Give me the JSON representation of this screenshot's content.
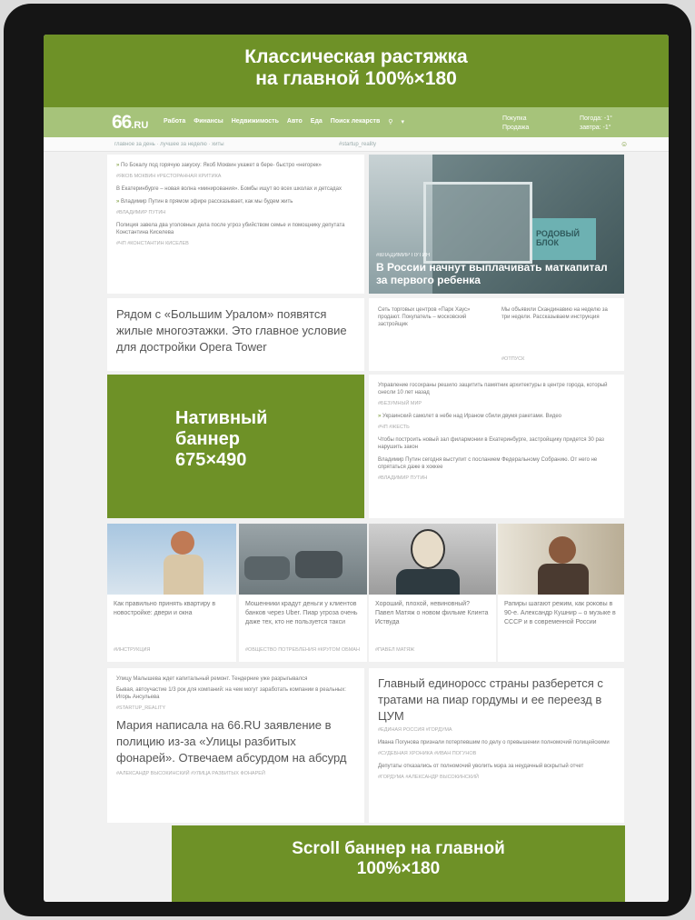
{
  "ads": {
    "top_line1": "Классическая растяжка",
    "top_line2": "на главной 100%×180",
    "native_line1": "Нативный",
    "native_line2": "баннер",
    "native_line3": "675×490",
    "bottom_line1": "Scroll баннер на главной",
    "bottom_line2": "100%×180"
  },
  "nav": {
    "logo": "66",
    "logo_suffix": ".RU",
    "items": [
      "Работа",
      "Финансы",
      "Недвижимость",
      "Авто",
      "Еда",
      "Поиск лекарств"
    ],
    "right1": [
      "Покупка",
      "Продажа"
    ],
    "right2": [
      "Погода: -1°",
      "завтра: -1°"
    ]
  },
  "subnav": {
    "left": "главное за день  ·  лучшее за неделю  ·  хиты",
    "middle": "#startup_reality"
  },
  "left_news": [
    {
      "text": "По Бокалу под горячую закуску: Якоб Моквин укажет в бере- быстро «негорек»",
      "tag": "#ЯКОБ МОКВИН  #РЕСТОРАННАЯ КРИТИКА"
    },
    {
      "text": "В Екатеринбурге – новая волна «минирования». Бомбы ищут во всех школах и детсадах",
      "tag": ""
    },
    {
      "text": "Владимир Путин в прямом эфире рассказывает, как мы будем жить",
      "tag": "#ВЛАДИМИР ПУТИН"
    },
    {
      "text": "Полиция завела два уголовных дела после угроз убийством семье и помощнику депутата Константина Киселева",
      "tag": "#ЧП  #КОНСТАНТИН КИСЕЛЕВ"
    }
  ],
  "main_photo": {
    "tag": "#ВЛАДИМИР ПУТИН",
    "title": "В России начнут выплачивать маткапитал за первого ребенка",
    "sign": "РОДОВЫЙ БЛОК"
  },
  "big_news": "Рядом с «Большим Уралом» появятся жилые многоэтажки. Это главное условие для достройки Opera Tower",
  "mid_news": [
    {
      "text": "Сеть торговых центров «Парк Хаус» продают. Покупатель – московский застройщик"
    },
    {
      "text": "Мы объявили Скандинавию на неделю за три недели. Рассказываем инструкция"
    }
  ],
  "mid_tag": "#ОТПУСК",
  "right_news": [
    {
      "text": "Управление госохраны решило защитить памятник архитектуры в центре города, который снесли 10 лет назад",
      "tag": "#БЕЗУМНЫЙ МИР"
    },
    {
      "text": "Украинский самолет в небе над Ираном сбили двумя ракетами. Видео",
      "tag": "#ЧП  #ЖЕСТЬ"
    },
    {
      "text": "Чтобы построить новый зал филармонии в Екатеринбурге, застройщику придется 30 раз нарушить закон",
      "tag": ""
    },
    {
      "text": "Владимир Путин сегодня выступит с посланием Федеральному Собранию. От него не спрятаться даже в хоккее",
      "tag": "#ВЛАДИМИР ПУТИН"
    }
  ],
  "tiles": [
    {
      "title": "Как правильно принять квартиру в новостройке: двери и окна",
      "tag": "#ИНСТРУКЦИЯ"
    },
    {
      "title": "Мошенники крадут деньги у клиентов банков через Uber. Пиар угроза очень даже тех, кто не пользуется такси",
      "tag": "#ОБЩЕСТВО ПОТРЕБЛЕНИЯ  #КРУГОМ ОБМАН"
    },
    {
      "title": "Хороший, плохой, невиновный? Павел Матяж о новом фильме Клинта Иствуда",
      "tag": "#ПАВЕЛ МАТЯЖ"
    },
    {
      "title": "Рапиры шагают режим, как роковы в 90-е. Александр Кушнир – о музыке в СССР и в современной России",
      "tag": ""
    }
  ],
  "bottom_left": [
    {
      "text": "Улицу Малышева ждет капитальный ремонт. Тендерние уже разрыгывался",
      "tag": ""
    },
    {
      "text": "Бывая, автоучастие 1/3 рок для компаний: на чем могут заработать компании в реальных: Игорь Ансульева",
      "tag": "#STARTUP_REALITY"
    }
  ],
  "bottom_big": "Мария написала на 66.RU заявление в полицию из-за «Улицы разбитых фонарей». Отвечаем абсурдом на абсурд",
  "bottom_big_tag": "#АЛЕКСАНДР ВЫСОКИНСКИЙ  #УЛИЦА РАЗБИТЫХ ФОНАРЕЙ",
  "bottom_right_big": "Главный единоросс страны разберется с тратами на пиар гордумы и ее переезд в ЦУМ",
  "bottom_right_tag": "#ЕДИНАЯ РОССИЯ  #ГОРДУМА",
  "bottom_right_news": [
    {
      "text": "Ивана Погунова признали потерпевшим по делу о превышении полномочий полицейскими",
      "tag": "#СУДЕБНАЯ ХРОНИКА  #ИВАН ПОГУНОВ"
    },
    {
      "text": "Депутаты отказались от полномочий уволить мэра за неудачный вскрытый отчет",
      "tag": "#ГОРДУМА  #АЛЕКСАНДР ВЫСОКИНСКИЙ"
    }
  ],
  "colors": {
    "ad_green": "#6e9127",
    "nav_green": "#a6c37a"
  }
}
